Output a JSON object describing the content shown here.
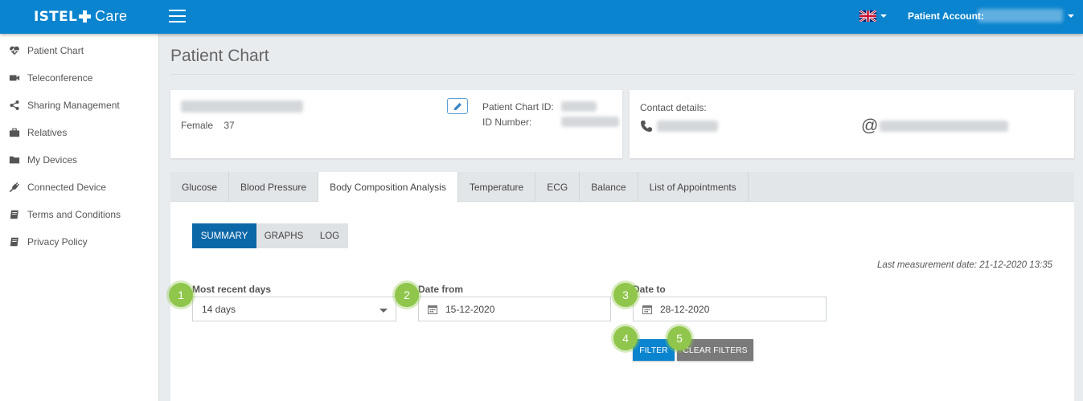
{
  "header": {
    "logo_bold": "ISTEL",
    "logo_light": "Care",
    "account_label": "Patient Account:"
  },
  "sidebar": {
    "items": [
      {
        "label": "Patient Chart",
        "icon": "heartbeat-icon"
      },
      {
        "label": "Teleconference",
        "icon": "video-camera-icon"
      },
      {
        "label": "Sharing Management",
        "icon": "share-icon"
      },
      {
        "label": "Relatives",
        "icon": "briefcase-icon"
      },
      {
        "label": "My Devices",
        "icon": "folder-icon"
      },
      {
        "label": "Connected Device",
        "icon": "plug-icon"
      },
      {
        "label": "Terms and Conditions",
        "icon": "book-icon"
      },
      {
        "label": "Privacy Policy",
        "icon": "book-icon"
      }
    ]
  },
  "page": {
    "title": "Patient Chart"
  },
  "patient": {
    "gender": "Female",
    "age": "37",
    "chart_id_label": "Patient Chart ID:",
    "id_number_label": "ID Number:"
  },
  "contact": {
    "label": "Contact details:",
    "email_symbol": "@"
  },
  "tabs": [
    {
      "label": "Glucose",
      "active": false
    },
    {
      "label": "Blood Pressure",
      "active": false
    },
    {
      "label": "Body Composition Analysis",
      "active": true
    },
    {
      "label": "Temperature",
      "active": false
    },
    {
      "label": "ECG",
      "active": false
    },
    {
      "label": "Balance",
      "active": false
    },
    {
      "label": "List of Appointments",
      "active": false
    }
  ],
  "view_toggle": {
    "summary": "SUMMARY",
    "graphs": "GRAPHS",
    "log": "LOG",
    "selected": "SUMMARY"
  },
  "last_measurement": "Last measurement date: 21-12-2020 13:35",
  "filters": {
    "recent_label": "Most recent days",
    "recent_value": "14 days",
    "from_label": "Date from",
    "from_value": "15-12-2020",
    "to_label": "Date to",
    "to_value": "28-12-2020",
    "filter_button": "FILTER",
    "clear_button": "CLEAR FILTERS"
  },
  "badges": [
    "1",
    "2",
    "3",
    "4",
    "5"
  ],
  "colors": {
    "header": "#0a84cf",
    "summary_active": "#0c67a8",
    "badge": "#8fc64b",
    "clear_button": "#7a7a7a"
  }
}
